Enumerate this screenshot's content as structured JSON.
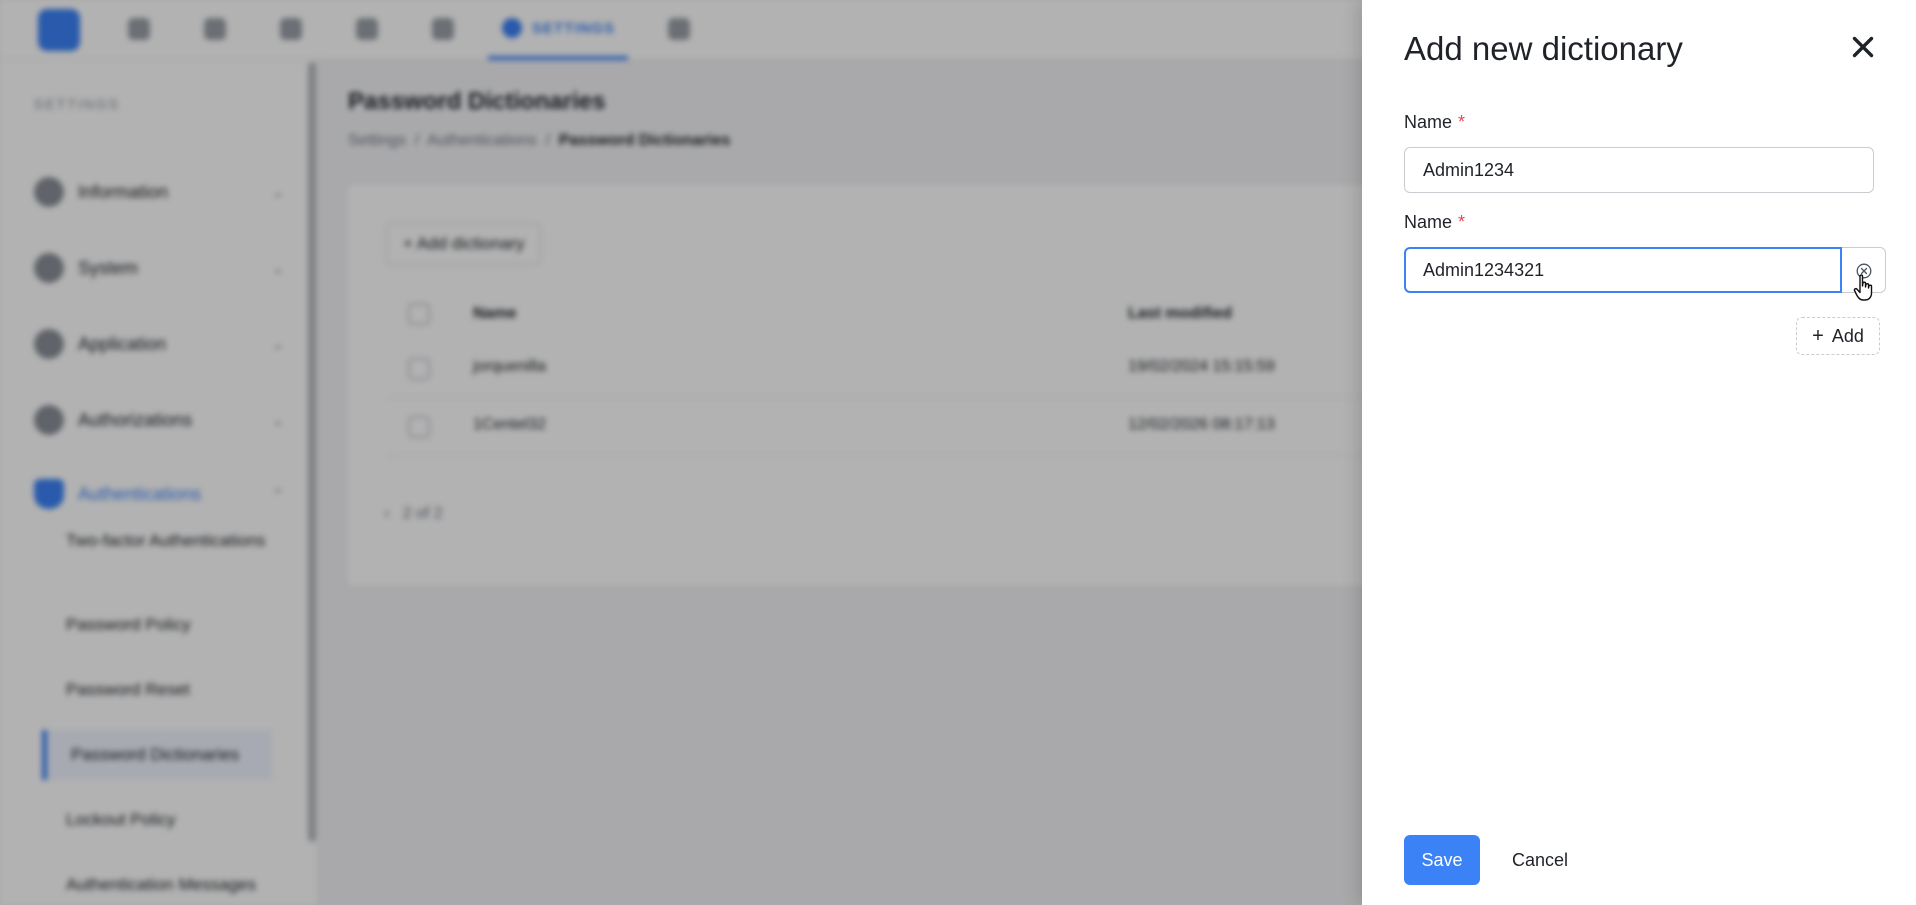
{
  "background": {
    "nav": {
      "active_tab": "SETTINGS"
    },
    "sidebar": {
      "heading": "SETTINGS",
      "items": [
        {
          "label": "Information",
          "icon": "info-icon"
        },
        {
          "label": "System",
          "icon": "server-icon"
        },
        {
          "label": "Application",
          "icon": "app-icon"
        },
        {
          "label": "Authorizations",
          "icon": "shield-icon"
        },
        {
          "label": "Authentications",
          "icon": "shield-icon"
        }
      ],
      "sub_items": [
        "Two-factor Authentications",
        "Password Policy",
        "Password Reset",
        "Password Dictionaries",
        "Lockout Policy",
        "Authentication Messages"
      ]
    },
    "main": {
      "title": "Password Dictionaries",
      "breadcrumb": [
        "Settings",
        "Authentications",
        "Password Dictionaries"
      ],
      "add_button": "+ Add dictionary",
      "columns": [
        "Name",
        "Last modified"
      ],
      "rows": [
        {
          "name": "jorquenilla",
          "modified": "19/02/2024 15:15:59"
        },
        {
          "name": "1Centel32",
          "modified": "12/02/2026 08:17:13"
        }
      ],
      "pager": "2 of 2"
    }
  },
  "drawer": {
    "title": "Add new dictionary",
    "fields": [
      {
        "label": "Name",
        "required_mark": "*",
        "value": "Admin1234"
      },
      {
        "label": "Name",
        "required_mark": "*",
        "value": "Admin1234321"
      }
    ],
    "add_label": "Add",
    "save_label": "Save",
    "cancel_label": "Cancel"
  },
  "colors": {
    "accent": "#3b82f6",
    "required": "#e5484d",
    "overlay": "rgba(0,0,0,0.30)"
  }
}
